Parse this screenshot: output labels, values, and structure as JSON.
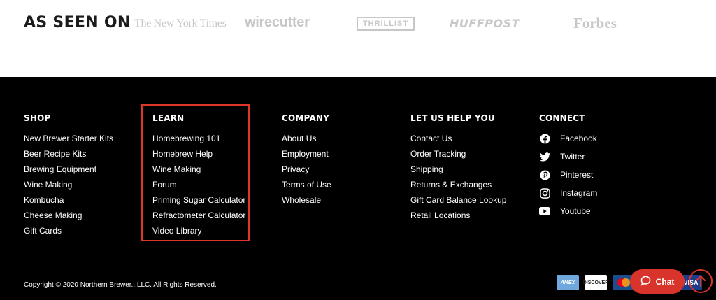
{
  "press": {
    "title": "AS SEEN ON",
    "logos": [
      "The New York Times",
      "wirecutter",
      "THRILLIST",
      "HUFFPOST",
      "Forbes"
    ]
  },
  "footer": {
    "columns": [
      {
        "heading": "SHOP",
        "items": [
          "New Brewer Starter Kits",
          "Beer Recipe Kits",
          "Brewing Equipment",
          "Wine Making",
          "Kombucha",
          "Cheese Making",
          "Gift Cards"
        ]
      },
      {
        "heading": "LEARN",
        "items": [
          "Homebrewing 101",
          "Homebrew Help",
          "Wine Making",
          "Forum",
          "Priming Sugar Calculator",
          "Refractometer Calculator",
          "Video Library"
        ]
      },
      {
        "heading": "COMPANY",
        "items": [
          "About Us",
          "Employment",
          "Privacy",
          "Terms of Use",
          "Wholesale"
        ]
      },
      {
        "heading": "LET US HELP YOU",
        "items": [
          "Contact Us",
          "Order Tracking",
          "Shipping",
          "Returns & Exchanges",
          "Gift Card Balance Lookup",
          "Retail Locations"
        ]
      }
    ],
    "connect": {
      "heading": "CONNECT",
      "items": [
        {
          "label": "Facebook",
          "icon": "facebook-icon"
        },
        {
          "label": "Twitter",
          "icon": "twitter-icon"
        },
        {
          "label": "Pinterest",
          "icon": "pinterest-icon"
        },
        {
          "label": "Instagram",
          "icon": "instagram-icon"
        },
        {
          "label": "Youtube",
          "icon": "youtube-icon"
        }
      ]
    },
    "copyright": "Copyright © 2020 Northern Brewer., LLC. All Rights Reserved.",
    "payments": [
      "AMEX",
      "DISCOVER",
      "mastercard",
      "VISA"
    ]
  },
  "chat": {
    "label": "Chat"
  },
  "colors": {
    "accent": "#d9342b",
    "footer_bg": "#000000",
    "logo_gray": "#c7c7c7"
  }
}
